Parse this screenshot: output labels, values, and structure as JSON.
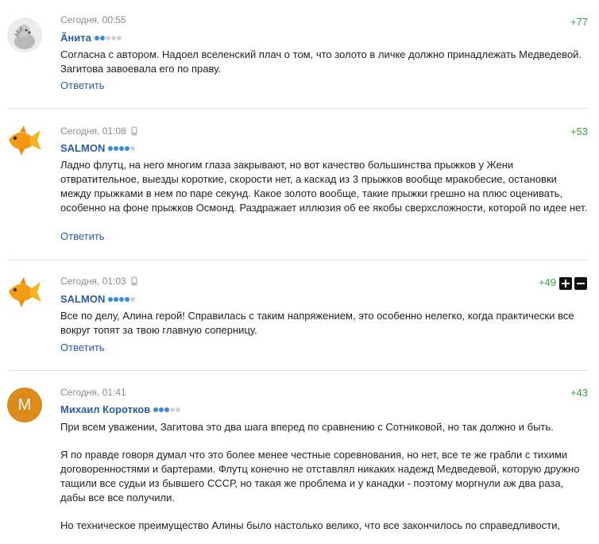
{
  "comments": [
    {
      "time": "Сегодня, 00:55",
      "user": "Ãнита",
      "rating_dots": 2,
      "score": "+77",
      "paragraphs": [
        "Согласна с автором. Надоел вселенский плач о том, что золото в личке должно принадлежать Медведевой. Загитова завоевала его по праву."
      ],
      "reply": "Ответить",
      "avatar": "gray-hedgehog-icon",
      "mobile": false
    },
    {
      "time": "Сегодня, 01:08",
      "user": "SALMON",
      "rating_dots": 4,
      "score": "+53",
      "paragraphs": [
        "Ладно флутц, на него многим глаза закрывают, но вот качество большинства прыжков у Жени отвратительное, выезды короткие, скорости нет, а каскад из 3 прыжков вообще мракобесие, остановки между прыжками в нем по паре секунд. Какое золото вообще, такие прыжки грешно на плюс оценивать, особенно на фоне прыжков Осмонд. Раздражает иллюзия об ее якобы сверхсложности, которой по идее нет."
      ],
      "reply": "Ответить",
      "avatar": "goldfish-icon",
      "mobile": true
    },
    {
      "time": "Сегодня, 01:03",
      "user": "SALMON",
      "rating_dots": 4,
      "score": "+49",
      "paragraphs": [
        "Все по делу, Алина герой! Справилась с таким напряжением, это особенно нелегко, когда практически все вокруг топят за твою главную соперницу."
      ],
      "reply": "Ответить",
      "avatar": "goldfish-icon",
      "mobile": true,
      "vote_buttons": true
    },
    {
      "time": "Сегодня, 01:41",
      "user": "Михаил Коротков",
      "rating_dots": 3,
      "score": "+43",
      "paragraphs": [
        "При всем уважении, Загитова это два шага вперед по сравнению с Сотниковой, но так должно и быть.",
        "Я по правде говоря думал что это более менее честные соревнования, но нет, все те же грабли с тихими договоренностями и бартерами. Флутц конечно не отставлял никаких надежд Медведевой, которую дружно тащили все судьи из бывшего СССР, но такая же проблема и у канадки - поэтому моргнули аж два раза, дабы  все все получили.",
        "Но техническое преимущество Алины было настолько велико, что все закончилось по справедливости,"
      ],
      "avatar_letter": "M",
      "avatar_color": "#dd8a1d",
      "mobile": false
    }
  ]
}
